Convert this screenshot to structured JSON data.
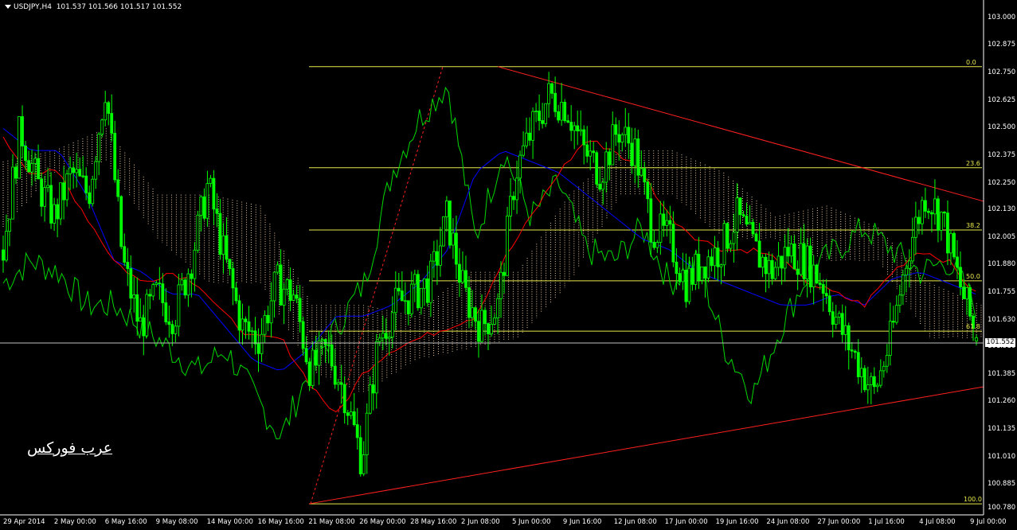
{
  "header": {
    "symbol": "USDJPY,H4",
    "open": "101.537",
    "high": "101.566",
    "low": "101.517",
    "close": "101.552"
  },
  "watermark": "عرب فوركس",
  "current_price": "101.552",
  "colors": {
    "background": "#000000",
    "candles": "#00ff00",
    "kijun": "#0000ff",
    "tenkan": "#ff0000",
    "chikou": "#00d800",
    "cloud": "#e8c8a0",
    "fibo": "#e8e84c",
    "trend": "#ff2020",
    "axis": "#ffffff"
  },
  "y_axis": {
    "labels": [
      "103.000",
      "102.875",
      "102.750",
      "102.625",
      "102.500",
      "102.375",
      "102.250",
      "102.130",
      "102.005",
      "101.880",
      "101.755",
      "101.630",
      "101.510",
      "101.385",
      "101.260",
      "101.135",
      "101.010",
      "100.885",
      "100.780"
    ]
  },
  "x_axis": {
    "labels": [
      "29 Apr 2014",
      "2 May 00:00",
      "6 May 16:00",
      "9 May 08:00",
      "14 May 00:00",
      "16 May 16:00",
      "21 May 08:00",
      "26 May 00:00",
      "28 May 16:00",
      "2 Jun 08:00",
      "5 Jun 00:00",
      "9 Jun 16:00",
      "12 Jun 08:00",
      "17 Jun 00:00",
      "19 Jun 16:00",
      "24 Jun 08:00",
      "27 Jun 00:00",
      "1 Jul 16:00",
      "4 Jul 08:00",
      "9 Jul 00:00"
    ]
  },
  "fibonacci": {
    "levels": [
      {
        "label": "0.0",
        "price": 102.78
      },
      {
        "label": "23.6",
        "price": 102.322
      },
      {
        "label": "38.2",
        "price": 102.04
      },
      {
        "label": "50.0",
        "price": 101.81
      },
      {
        "label": "61.8",
        "price": 101.582
      },
      {
        "label": "100.0",
        "price": 100.8
      }
    ]
  },
  "chart_data": {
    "type": "candlestick",
    "indicators": [
      "Ichimoku Kinko Hyo",
      "Fibonacci retracement",
      "trend lines"
    ],
    "visible_prices": {
      "min": 100.76,
      "max": 103.06
    },
    "fibonacci_high": 102.78,
    "fibonacci_low": 100.8,
    "last": {
      "open": 101.537,
      "high": 101.566,
      "low": 101.517,
      "close": 101.552
    },
    "close_path": [
      101.95,
      102.5,
      102.25,
      102.1,
      102.3,
      102.2,
      102.7,
      101.9,
      101.6,
      101.75,
      101.65,
      101.9,
      102.25,
      101.9,
      101.6,
      101.55,
      101.8,
      101.75,
      101.4,
      101.5,
      101.3,
      101.0,
      101.55,
      101.7,
      101.75,
      101.8,
      102.1,
      101.75,
      101.6,
      101.7,
      102.3,
      102.5,
      102.65,
      102.6,
      102.4,
      102.3,
      102.5,
      102.4,
      102.05,
      102.0,
      101.8,
      101.9,
      101.95,
      102.1,
      101.95,
      101.85,
      101.95,
      101.9,
      101.8,
      101.6,
      101.45,
      101.3,
      101.55,
      101.95,
      102.2,
      102.1,
      101.8,
      101.55
    ],
    "tenkan_path": [
      102.45,
      102.3,
      102.3,
      102.1,
      101.9,
      101.8,
      101.85,
      101.8,
      101.65,
      101.55,
      101.55,
      101.35,
      101.2,
      101.4,
      101.5,
      101.55,
      101.6,
      101.65,
      101.9,
      102.1,
      102.3,
      102.45,
      102.4,
      102.3,
      102.1,
      102.0,
      101.95,
      101.95,
      101.9,
      101.8,
      101.75,
      101.7,
      101.85,
      101.95,
      101.9,
      101.75
    ],
    "kijun_path": [
      102.5,
      102.4,
      102.4,
      102.2,
      101.9,
      101.85,
      101.75,
      101.75,
      101.6,
      101.45,
      101.4,
      101.5,
      101.65,
      101.65,
      101.7,
      101.8,
      101.95,
      102.3,
      102.4,
      102.35,
      102.3,
      102.2,
      102.1,
      102.0,
      101.95,
      101.85,
      101.8,
      101.75,
      101.7,
      101.7,
      101.75,
      101.7,
      101.82,
      101.85,
      101.8,
      101.75
    ],
    "chikou_path": [
      101.8,
      101.9,
      101.85,
      101.7,
      101.7,
      101.6,
      101.5,
      101.4,
      101.5,
      101.3,
      101.1,
      101.4,
      101.6,
      101.8,
      102.3,
      102.55,
      102.7,
      102.0,
      102.4,
      102.1,
      102.25,
      101.95,
      101.9,
      102.05,
      101.8,
      101.9,
      101.5,
      101.3,
      101.6,
      101.85,
      101.95,
      102.05,
      101.95,
      101.85,
      101.9,
      101.7
    ],
    "cloud_path": [
      {
        "a": 102.35,
        "b": 102.05
      },
      {
        "a": 102.4,
        "b": 102.3
      },
      {
        "a": 102.5,
        "b": 102.35
      },
      {
        "a": 102.2,
        "b": 102.0
      },
      {
        "a": 102.2,
        "b": 101.8
      },
      {
        "a": 102.15,
        "b": 101.8
      },
      {
        "a": 101.7,
        "b": 101.4
      },
      {
        "a": 101.7,
        "b": 101.3
      },
      {
        "a": 101.65,
        "b": 101.45
      },
      {
        "a": 101.85,
        "b": 101.5
      },
      {
        "a": 101.85,
        "b": 101.55
      },
      {
        "a": 102.2,
        "b": 101.8
      },
      {
        "a": 102.4,
        "b": 102.2
      },
      {
        "a": 102.4,
        "b": 102.2
      },
      {
        "a": 102.3,
        "b": 102.0
      },
      {
        "a": 102.1,
        "b": 102.0
      },
      {
        "a": 102.15,
        "b": 101.9
      },
      {
        "a": 102.05,
        "b": 101.9
      },
      {
        "a": 101.8,
        "b": 101.55
      },
      {
        "a": 101.7,
        "b": 101.55
      }
    ],
    "trend_lines": [
      {
        "name": "resistance",
        "from": 102.78,
        "to": 102.17
      },
      {
        "name": "support",
        "from": 100.8,
        "to": 101.33
      }
    ]
  }
}
